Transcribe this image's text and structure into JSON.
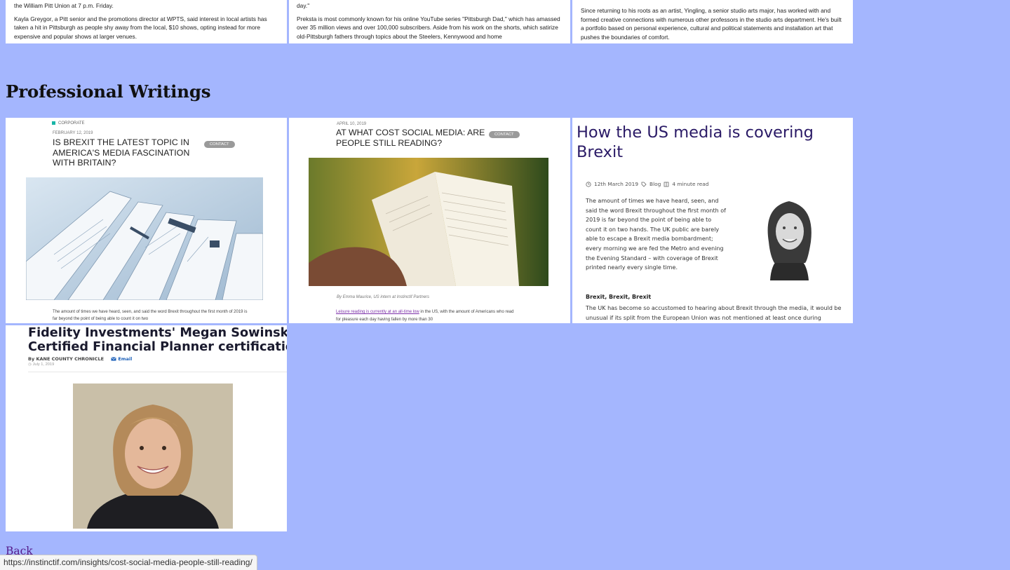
{
  "top_cards": [
    {
      "paragraphs": [
        "the William Pitt Union at 7 p.m. Friday.",
        "Kayla Greygor, a Pitt senior and the promotions director at WPTS, said interest in local artists has taken a hit in Pittsburgh as people shy away from the local, $10 shows, opting instead for more expensive and popular shows at larger venues."
      ]
    },
    {
      "paragraphs": [
        "day.\"",
        "Preksta is most commonly known for his online YouTube series \"Pittsburgh Dad,\" which has amassed over 35 million views and over 100,000 subscribers. Aside from his work on the shorts, which satirize old-Pittsburgh fathers through topics about the Steelers, Kennywood and home"
      ]
    },
    {
      "paragraphs": [
        "Since returning to his roots as an artist, Yingling, a senior studio arts major, has worked with and formed creative connections with numerous other professors in the studio arts department. He's built a portfolio based on personal experience, cultural and political statements and installation art that pushes the boundaries of comfort."
      ]
    }
  ],
  "section": {
    "title": "Professional Writings"
  },
  "writings": {
    "card1": {
      "category": "CORPORATE",
      "date": "FEBRUARY 12, 2019",
      "title": "IS BREXIT THE LATEST TOPIC IN AMERICA'S MEDIA FASCINATION WITH BRITAIN?",
      "pill": "CONTACT",
      "body": "The amount of times we have heard, seen, and said the word Brexit throughout the first month of 2019 is far beyond the point of being able to count it on two"
    },
    "card2": {
      "date": "APRIL 10, 2019",
      "title": "AT WHAT COST SOCIAL MEDIA: ARE PEOPLE STILL READING?",
      "pill": "CONTACT",
      "byline": "By Emma Maurice, US intern at Instinctif Partners",
      "body_link": "Leisure reading is currently at an all-time low",
      "body_rest": " in the US, with the amount of Americans who read for pleasure each day having fallen by more than 30"
    },
    "card3": {
      "title": "How the US media is covering Brexit",
      "date": "12th March 2019",
      "tag": "Blog",
      "read_time": "4 minute read",
      "body": "The amount of times we have heard, seen, and said the word Brexit throughout the first month of 2019 is far beyond the point of being able to count it on two hands. The UK public are barely able to escape a Brexit media bombardment; every morning we are fed the Metro and evening the Evening Standard – with coverage of Brexit printed nearly every single time.",
      "subheading": "Brexit, Brexit, Brexit",
      "body2": "The UK has become so accustomed to hearing about Brexit through the media, it would be unusual if its split from the European Union was not mentioned at least once during"
    },
    "card4": {
      "headline_line1": "Fidelity Investments' Megan Sowinski rece",
      "headline_line2": "Certified Financial Planner certification",
      "byline": "By KANE COUNTY CHRONICLE",
      "email": "Email",
      "date": "July 1, 2019"
    }
  },
  "footer": {
    "back_label": "Back"
  },
  "status_bar": {
    "url": "https://instinctif.com/insights/cost-social-media-people-still-reading/"
  },
  "colors": {
    "page_background": "#a4b6fe",
    "link_visited": "#551a8b",
    "card3_title": "#2a1a66"
  }
}
